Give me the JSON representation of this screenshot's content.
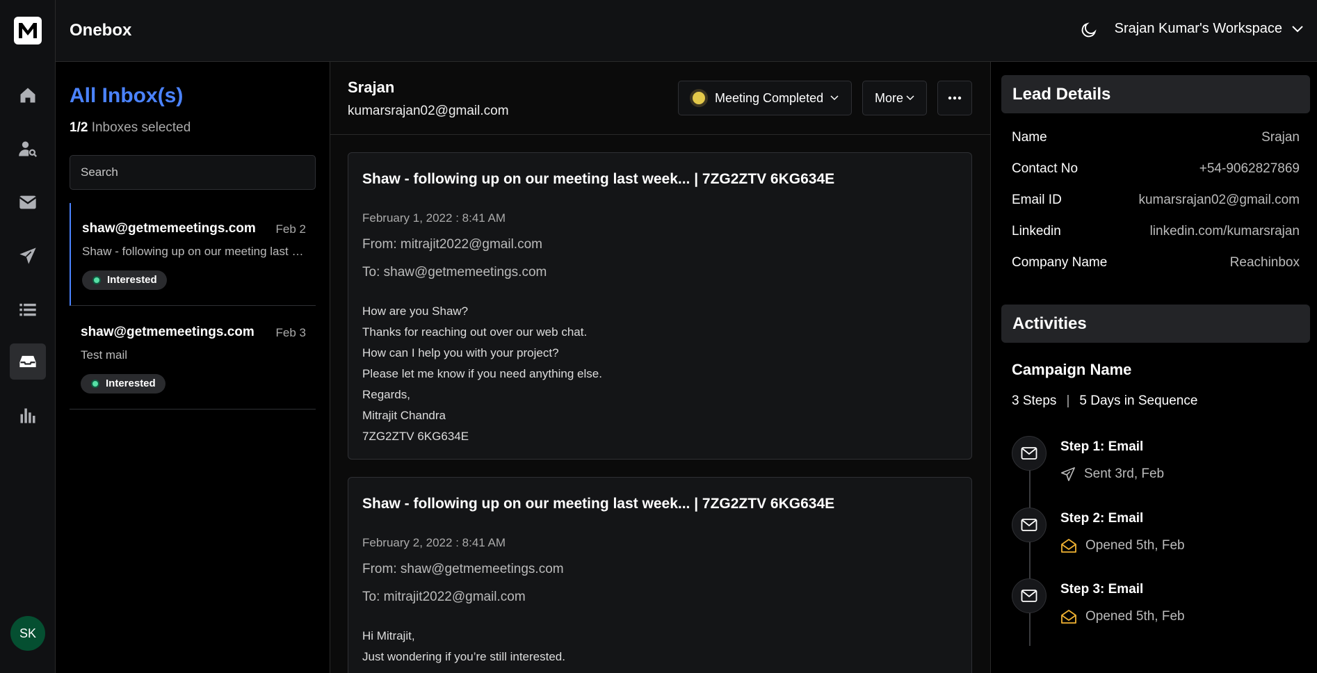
{
  "app": {
    "brand": "Onebox",
    "workspace": "Srajan Kumar's Workspace",
    "avatar_initials": "SK"
  },
  "rail": {
    "items": [
      "home-icon",
      "user-search-icon",
      "mail-icon",
      "send-icon",
      "list-icon",
      "inbox-icon",
      "bar-chart-icon"
    ],
    "active": "inbox-icon"
  },
  "inbox": {
    "title": "All Inbox(s)",
    "selected_count": "1/2",
    "selected_label": "Inboxes selected",
    "search_placeholder": "Search",
    "items": [
      {
        "from": "shaw@getmemeetings.com",
        "date": "Feb 2",
        "snippet": "Shaw - following up on our meeting last week...",
        "tag": "Interested"
      },
      {
        "from": "shaw@getmemeetings.com",
        "date": "Feb 3",
        "snippet": "Test mail",
        "tag": "Interested"
      }
    ]
  },
  "thread": {
    "name": "Srajan",
    "email": "kumarsrajan02@gmail.com",
    "status": "Meeting Completed",
    "more_label": "More",
    "status_color": "#e3c84a",
    "messages": [
      {
        "subject": "Shaw - following up on our meeting last week... | 7ZG2ZTV 6KG634E",
        "date": "February 1, 2022 : 8:41 AM",
        "from": "From: mitrajit2022@gmail.com",
        "to": "To: shaw@getmemeetings.com",
        "body": [
          "How are you Shaw?",
          "Thanks for reaching out over our web chat.",
          "How can I help you with your project?",
          "Please let me know if you need anything else.",
          "Regards,",
          "Mitrajit Chandra",
          "7ZG2ZTV 6KG634E"
        ]
      },
      {
        "subject": "Shaw - following up on our meeting last week... | 7ZG2ZTV 6KG634E",
        "date": "February 2, 2022 : 8:41 AM",
        "from": "From: shaw@getmemeetings.com",
        "to": "To: mitrajit2022@gmail.com",
        "body": [
          "Hi Mitrajit,",
          "Just wondering if you’re still interested."
        ]
      }
    ]
  },
  "lead": {
    "title": "Lead Details",
    "rows": [
      {
        "label": "Name",
        "value": "Srajan"
      },
      {
        "label": "Contact No",
        "value": "+54-9062827869"
      },
      {
        "label": "Email ID",
        "value": "kumarsrajan02@gmail.com"
      },
      {
        "label": "Linkedin",
        "value": "linkedin.com/kumarsrajan"
      },
      {
        "label": "Company Name",
        "value": "Reachinbox"
      }
    ]
  },
  "activities": {
    "title": "Activities",
    "campaign_name": "Campaign Name",
    "steps_count": "3 Steps",
    "sequence": "5 Days in Sequence",
    "steps": [
      {
        "title": "Step 1: Email",
        "status": "Sent 3rd, Feb",
        "status_icon": "send-icon"
      },
      {
        "title": "Step 2: Email",
        "status": "Opened 5th, Feb",
        "status_icon": "mail-open-icon"
      },
      {
        "title": "Step 3: Email",
        "status": "Opened 5th, Feb",
        "status_icon": "mail-open-icon"
      }
    ],
    "opened_color": "#f0b232"
  }
}
